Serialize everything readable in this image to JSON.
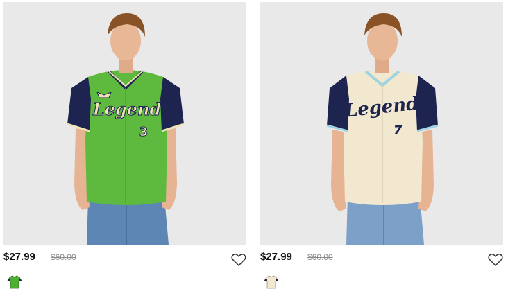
{
  "products": [
    {
      "price": "$27.99",
      "original_price": "$60.00",
      "jersey_text": "Legend",
      "jersey_number": "3",
      "body_color": "#5dba3f",
      "sleeve_color": "#1e2450",
      "text_color": "#efe3b7",
      "trim_color": "#efe3b7",
      "wishlist_icon": "heart-outline-icon",
      "swatch_icon": "green-jersey-swatch-icon"
    },
    {
      "price": "$27.99",
      "original_price": "$60.00",
      "jersey_text": "Legend",
      "jersey_number": "7",
      "body_color": "#f1e8cf",
      "sleeve_color": "#1e2450",
      "text_color": "#1e2450",
      "trim_color": "#9fd3e3",
      "wishlist_icon": "heart-outline-icon",
      "swatch_icon": "cream-jersey-swatch-icon"
    }
  ]
}
